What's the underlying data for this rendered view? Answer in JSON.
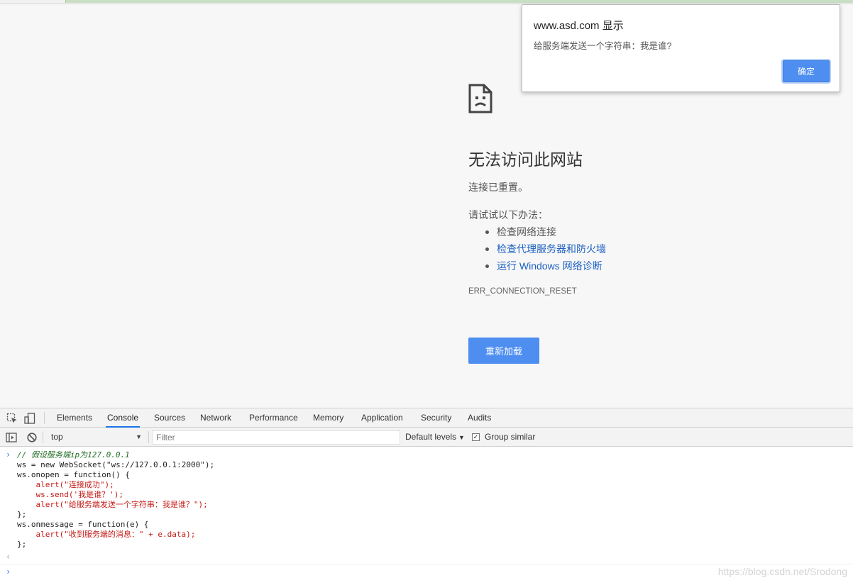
{
  "error_page": {
    "title": "无法访问此网站",
    "subtitle": "连接已重置。",
    "try_label": "请试试以下办法：",
    "suggestions": [
      "检查网络连接",
      "检查代理服务器和防火墙",
      "运行 Windows 网络诊断"
    ],
    "error_code": "ERR_CONNECTION_RESET",
    "reload_label": "重新加载"
  },
  "dialog": {
    "title": "www.asd.com 显示",
    "message": "给服务端发送一个字符串：我是谁?",
    "ok_label": "确定"
  },
  "devtools": {
    "tabs": [
      "Elements",
      "Console",
      "Sources",
      "Network",
      "Performance",
      "Memory",
      "Application",
      "Security",
      "Audits"
    ],
    "active_tab": "Console",
    "accent_color": "#1a73e8",
    "toolbar": {
      "context": "top",
      "filter_placeholder": "Filter",
      "levels": "Default levels",
      "group_similar": "Group similar",
      "group_similar_checked": true
    },
    "console": {
      "code_lines": [
        "// 假设服务端ip为127.0.0.1",
        "ws = new WebSocket(\"ws://127.0.0.1:2000\");",
        "ws.onopen = function() {",
        "    alert(\"连接成功\");",
        "    ws.send('我是谁？');",
        "    alert(\"给服务端发送一个字符串：我是谁？\");",
        "};",
        "ws.onmessage = function(e) {",
        "    alert(\"收到服务端的消息：\" + e.data);",
        "};"
      ]
    }
  },
  "watermark": "https://blog.csdn.net/Srodong",
  "colors": {
    "primary_button": "#4d8ef0",
    "link": "#1b5fc2",
    "page_background": "#f7f7f7"
  }
}
